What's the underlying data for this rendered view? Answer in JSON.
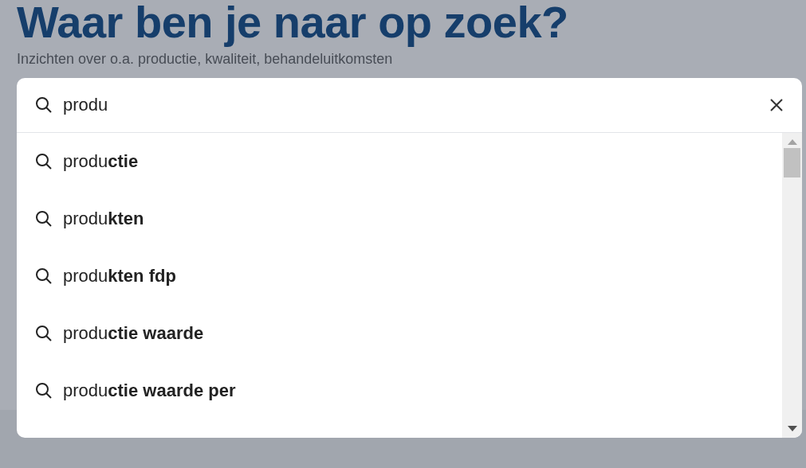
{
  "heading": "Waar ben je naar op zoek?",
  "subtitle": "Inzichten over o.a. productie, kwaliteit, behandeluitkomsten",
  "search": {
    "value": "produ"
  },
  "suggestions": [
    {
      "text": "produ**ctie**"
    },
    {
      "text": "produ**kten**"
    },
    {
      "text": "produ**kten fdp**"
    },
    {
      "text": "produ**ctie waarde**"
    },
    {
      "text": "produ**ctie waarde per**"
    }
  ]
}
